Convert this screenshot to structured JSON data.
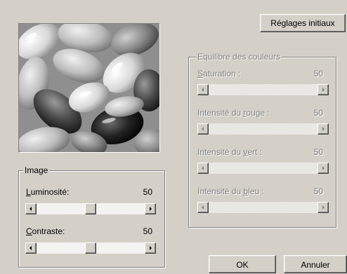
{
  "buttons": {
    "reset": "Réglages initiaux",
    "ok": "OK",
    "cancel": "Annuler"
  },
  "image_group": {
    "title": "Image",
    "brightness": {
      "label": "Luminosité:",
      "accel": "L",
      "value": "50",
      "level": 0.5
    },
    "contrast": {
      "label": "Contraste:",
      "accel": "C",
      "value": "50",
      "level": 0.5
    }
  },
  "color_group": {
    "title": "Equilibre des couleurs",
    "saturation": {
      "label": "Saturation :",
      "value": "50",
      "level": 0.5
    },
    "red": {
      "label": "Intensité du rouge :",
      "value": "50",
      "level": 0.5
    },
    "green": {
      "label": "Intensité du vert :",
      "value": "50",
      "level": 0.5
    },
    "blue": {
      "label": "Intensité du bleu :",
      "value": "50",
      "level": 0.5
    }
  },
  "colors": {
    "face": "#d4d0c8",
    "shadow": "#808080",
    "highlight": "#ffffff",
    "disabled_text": "#808080"
  },
  "icons": [
    "scroll-left-arrow-icon",
    "scroll-right-arrow-icon"
  ]
}
